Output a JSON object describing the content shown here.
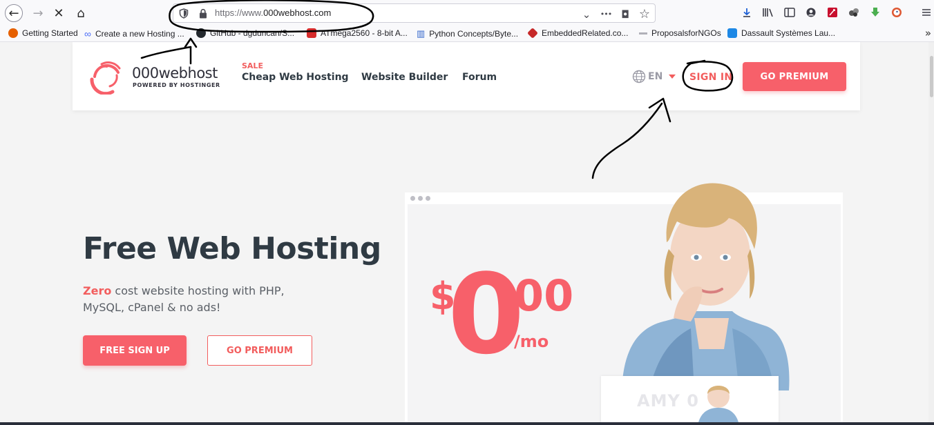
{
  "browser": {
    "url_prefix": "https://www.",
    "url_domain": "000webhost.com",
    "nav": {
      "back": "←",
      "forward": "→",
      "stop": "✕",
      "home": "⌂"
    },
    "url_actions": {
      "dropdown": "⌄",
      "more": "•••",
      "pocket": "◘",
      "bookmark_star": "☆"
    },
    "toolbar_icons": [
      "download-icon",
      "library-icon",
      "sidebar-icon",
      "account-icon",
      "extension-red-icon",
      "extension-dots-icon",
      "extension-green-icon",
      "duckduckgo-icon",
      "menu-icon"
    ],
    "bookmarks": [
      {
        "label": "Getting Started",
        "color": "#e66000"
      },
      {
        "label": "Create a new Hosting ...",
        "color": "#4a6cf7"
      },
      {
        "label": "GitHub - dgduncan/S...",
        "color": "#24292e"
      },
      {
        "label": "ATmega2560 - 8-bit A...",
        "color": "#d62b2b"
      },
      {
        "label": "Python Concepts/Byte...",
        "color": "#3366cc"
      },
      {
        "label": "EmbeddedRelated.co...",
        "color": "#c62828"
      },
      {
        "label": "ProposalsforNGOs",
        "color": "#b0b0b8"
      },
      {
        "label": "Dassault Systèmes Lau...",
        "color": "#1e88e5"
      }
    ],
    "bookmarks_overflow": "»"
  },
  "site": {
    "logo": {
      "name": "000webhost",
      "sub": "POWERED BY HOSTINGER"
    },
    "nav": {
      "sale_badge": "SALE",
      "cheap_hosting": "Cheap Web Hosting",
      "website_builder": "Website Builder",
      "forum": "Forum"
    },
    "language": "EN",
    "sign_in": "SIGN IN",
    "go_premium": "GO PREMIUM"
  },
  "hero": {
    "title": "Free Web Hosting",
    "subtitle_highlight": "Zero",
    "subtitle_rest": " cost website hosting with PHP, MySQL, cPanel & no ads!",
    "signup_button": "FREE SIGN UP",
    "premium_button": "GO PREMIUM"
  },
  "pricing": {
    "currency": "$",
    "whole": "0",
    "cents": "00",
    "period": "/mo"
  },
  "mini_card": {
    "name": "AMY 0"
  },
  "colors": {
    "brand": "#f7606a",
    "text_dark": "#2f3a43"
  }
}
